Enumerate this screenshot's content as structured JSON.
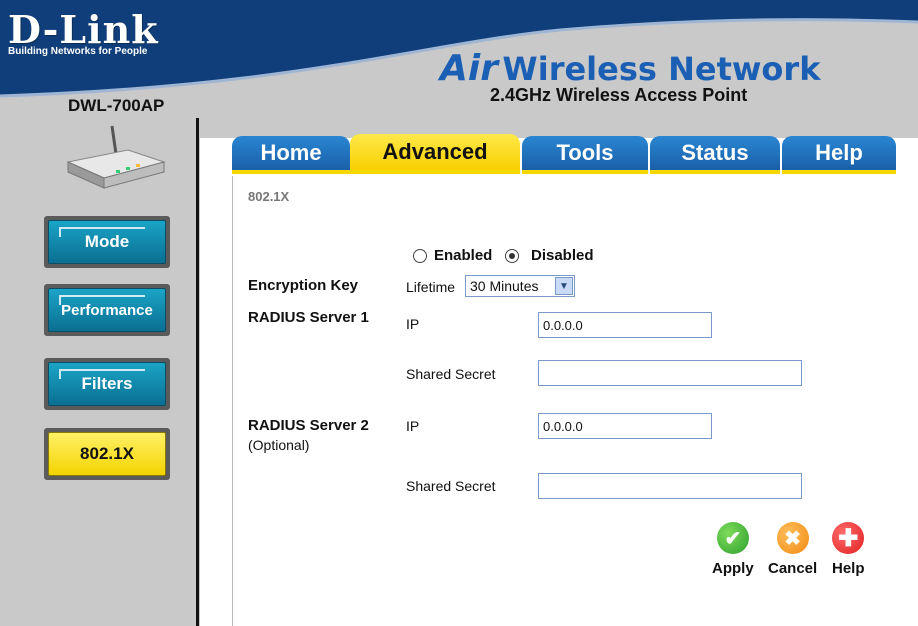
{
  "brand": {
    "logo": "D-Link",
    "tagline": "Building Networks for People",
    "model": "DWL-700AP"
  },
  "product": {
    "air": "Air",
    "title": "Wireless Network",
    "subtitle": "2.4GHz Wireless Access Point"
  },
  "tabs": [
    {
      "label": "Home",
      "active": false
    },
    {
      "label": "Advanced",
      "active": true
    },
    {
      "label": "Tools",
      "active": false
    },
    {
      "label": "Status",
      "active": false
    },
    {
      "label": "Help",
      "active": false
    }
  ],
  "sidebar": {
    "items": [
      {
        "label": "Mode",
        "active": false
      },
      {
        "label": "Performance",
        "active": false
      },
      {
        "label": "Filters",
        "active": false
      },
      {
        "label": "802.1X",
        "active": true
      }
    ]
  },
  "page": {
    "crumb": "802.1X",
    "enabled_label": "Enabled",
    "disabled_label": "Disabled",
    "selected": "Disabled",
    "encryption_key_label": "Encryption Key",
    "lifetime_label": "Lifetime",
    "lifetime_value": "30 Minutes",
    "radius1_label": "RADIUS Server 1",
    "radius2_label": "RADIUS Server 2",
    "optional_label": "(Optional)",
    "ip_label": "IP",
    "shared_secret_label": "Shared Secret",
    "radius1_ip": "0.0.0.0",
    "radius1_secret": "",
    "radius2_ip": "0.0.0.0",
    "radius2_secret": ""
  },
  "actions": {
    "apply": "Apply",
    "cancel": "Cancel",
    "help": "Help"
  },
  "colors": {
    "tab_blue": "#1a5fa8",
    "tab_active": "#f7cf00",
    "nav_teal": "#0b6f92",
    "nav_active": "#f3d400",
    "apply_green": "#2e9e2e",
    "cancel_orange": "#f08a12",
    "help_red": "#e02020"
  }
}
